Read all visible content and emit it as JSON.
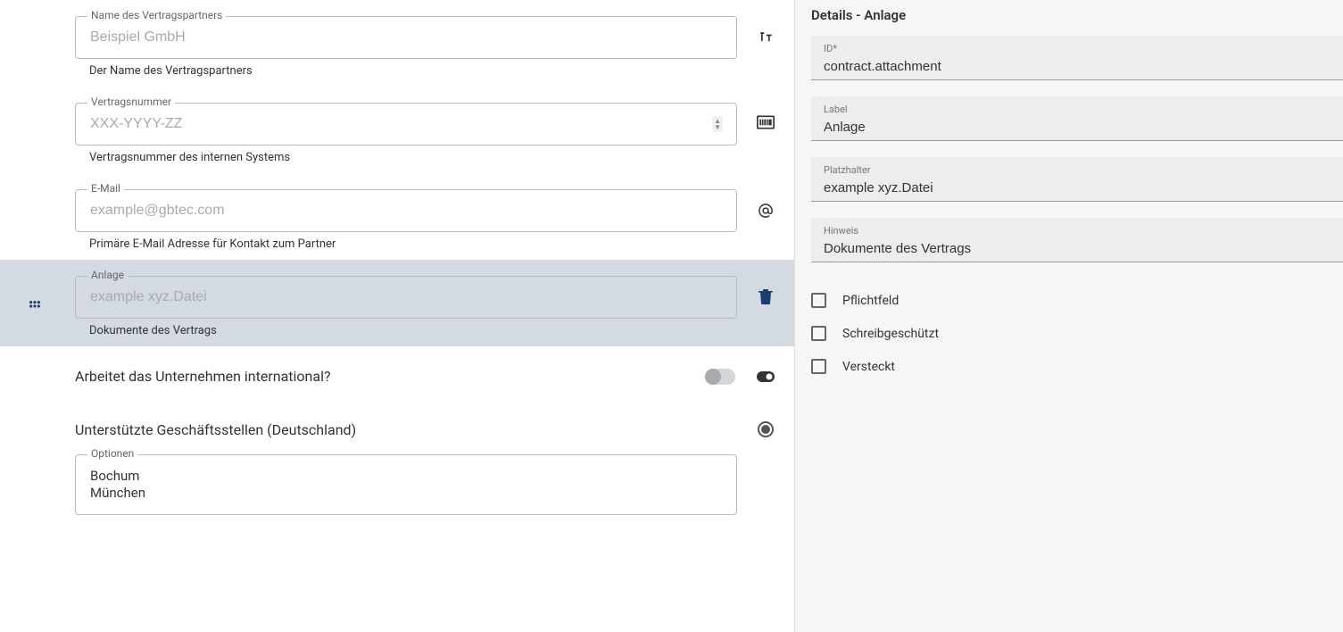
{
  "fields": [
    {
      "label": "Name des Vertragspartners",
      "placeholder": "Beispiel GmbH",
      "help": "Der Name des Vertragspartners"
    },
    {
      "label": "Vertragsnummer",
      "placeholder": "XXX-YYYY-ZZ",
      "help": "Vertragsnummer des internen Systems"
    },
    {
      "label": "E-Mail",
      "placeholder": "example@gbtec.com",
      "help": "Primäre E-Mail Adresse für Kontakt zum Partner"
    },
    {
      "label": "Anlage",
      "placeholder": "example xyz.Datei",
      "help": "Dokumente des Vertrags"
    }
  ],
  "question": {
    "text": "Arbeitet das Unternehmen international?"
  },
  "section": {
    "title": "Unterstützte Geschäftsstellen (Deutschland)",
    "options_label": "Optionen",
    "options": [
      "Bochum",
      "München"
    ]
  },
  "details": {
    "title": "Details - Anlage",
    "id_label": "ID*",
    "id_value": "contract.attachment",
    "label_label": "Label",
    "label_value": "Anlage",
    "placeholder_label": "Platzhalter",
    "placeholder_value": "example xyz.Datei",
    "hint_label": "Hinweis",
    "hint_value": "Dokumente des Vertrags",
    "checkboxes": {
      "required": "Pflichtfeld",
      "readonly": "Schreibgeschützt",
      "hidden": "Versteckt"
    }
  }
}
